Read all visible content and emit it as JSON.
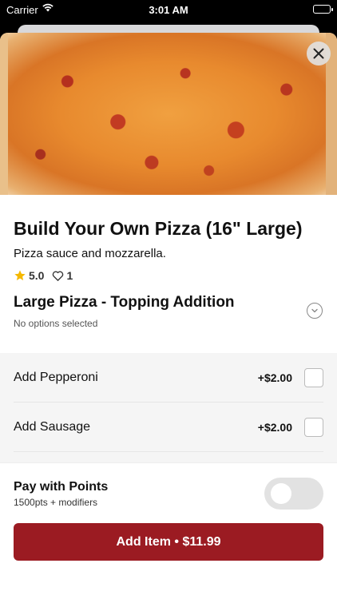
{
  "status_bar": {
    "carrier": "Carrier",
    "time": "3:01 AM"
  },
  "item": {
    "title": "Build Your Own Pizza (16\" Large)",
    "description": "Pizza sauce and mozzarella.",
    "rating": "5.0",
    "likes": "1"
  },
  "modifier_group": {
    "title": "Large Pizza - Topping Addition",
    "status": "No options selected",
    "options": [
      {
        "label": "Add Pepperoni",
        "price": "+$2.00"
      },
      {
        "label": "Add Sausage",
        "price": "+$2.00"
      }
    ]
  },
  "points": {
    "title": "Pay with Points",
    "subtitle": "1500pts + modifiers",
    "enabled": false
  },
  "cta": {
    "label": "Add Item • $11.99"
  },
  "colors": {
    "accent": "#9b1b22",
    "star": "#f5b800"
  }
}
